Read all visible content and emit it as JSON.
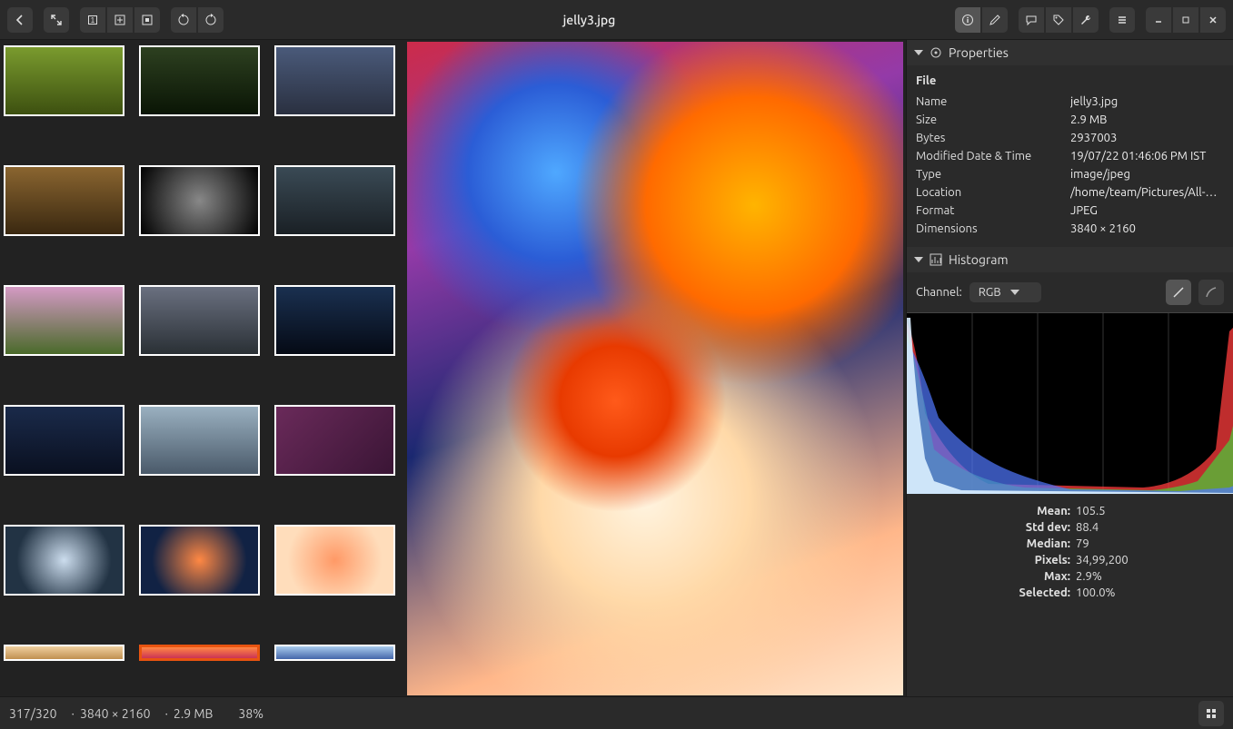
{
  "title": "jelly3.jpg",
  "properties": {
    "section_title": "Properties",
    "file_heading": "File",
    "rows": [
      {
        "key": "Name",
        "val": "jelly3.jpg"
      },
      {
        "key": "Size",
        "val": "2.9 MB"
      },
      {
        "key": "Bytes",
        "val": "2937003"
      },
      {
        "key": "Modified Date & Time",
        "val": "19/07/22 01:46:06 PM IST"
      },
      {
        "key": "Type",
        "val": "image/jpeg"
      },
      {
        "key": "Location",
        "val": "/home/team/Pictures/All-W…"
      },
      {
        "key": "Format",
        "val": "JPEG"
      },
      {
        "key": "Dimensions",
        "val": "3840 × 2160"
      }
    ]
  },
  "histogram": {
    "section_title": "Histogram",
    "channel_label": "Channel:",
    "channel_value": "RGB",
    "stats": [
      {
        "key": "Mean:",
        "val": "105.5"
      },
      {
        "key": "Std dev:",
        "val": "88.4"
      },
      {
        "key": "Median:",
        "val": "79"
      },
      {
        "key": "Pixels:",
        "val": "34,99,200"
      },
      {
        "key": "Max:",
        "val": "2.9%"
      },
      {
        "key": "Selected:",
        "val": "100.0%"
      }
    ]
  },
  "status": {
    "position": "317/320",
    "dimensions": "3840 × 2160",
    "size": "2.9 MB",
    "zoom": "38%"
  },
  "thumbs": {
    "count_visible_full_rows": 6,
    "cols": 3,
    "selected_index": 19
  }
}
